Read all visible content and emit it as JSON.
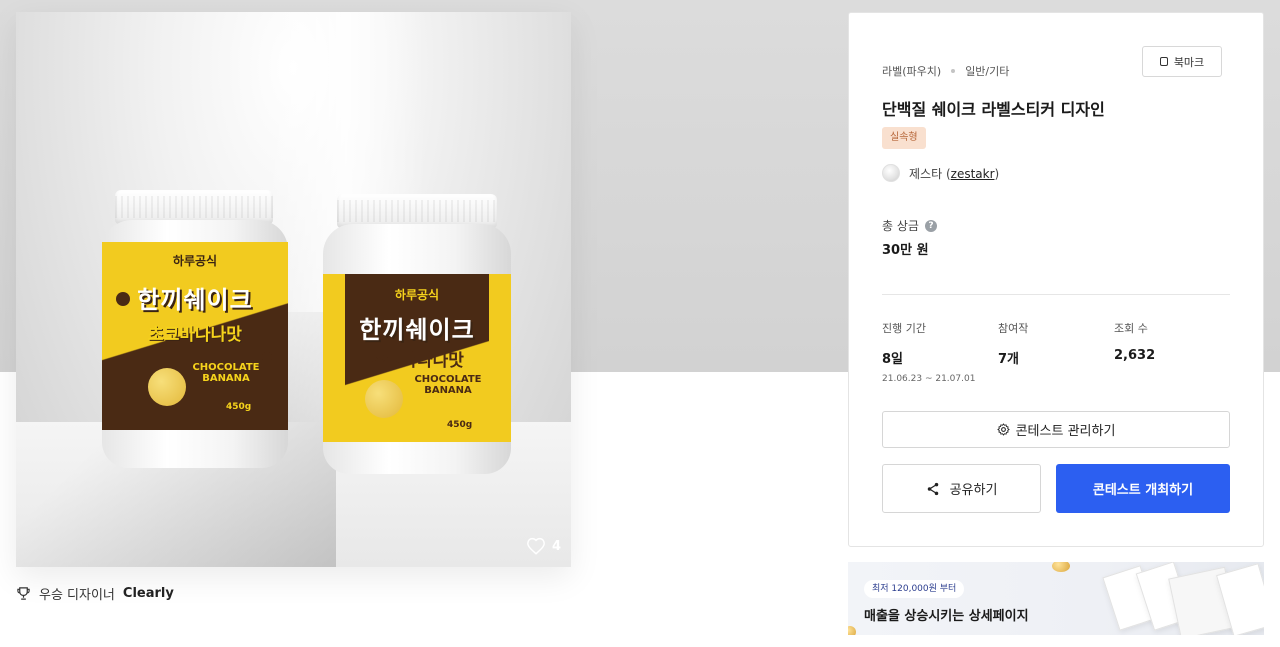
{
  "hero": {
    "like_count": "4",
    "jar_left": {
      "brand": "하루공식",
      "product": "한끼쉐이크",
      "flavor": "초코바나나맛",
      "english": "CHOCOLATE BANANA",
      "weight": "450g"
    },
    "jar_right": {
      "brand": "하루공식",
      "product": "한끼쉐이크",
      "flavor": "초코바나나맛",
      "english": "CHOCOLATE BANANA",
      "weight": "450g"
    }
  },
  "winner": {
    "label": "우승 디자이너",
    "name": "Clearly"
  },
  "card": {
    "breadcrumb": [
      "라벨(파우치)",
      "일반/기타"
    ],
    "bookmark_label": "북마크",
    "title": "단백질 쉐이크 라벨스티커 디자인",
    "tag": "실속형",
    "host_name": "제스타",
    "host_handle_open": "(",
    "host_handle": "zestakr",
    "host_handle_close": ")",
    "prize_label": "총 상금",
    "prize_value": "30만 원",
    "stats": {
      "period_label": "진행 기간",
      "period_value": "8일",
      "period_dates": "21.06.23 ~ 21.07.01",
      "entries_label": "참여작",
      "entries_value": "7개",
      "views_label": "조회 수",
      "views_value": "2,632"
    },
    "manage_label": "콘테스트 관리하기",
    "share_label": "공유하기",
    "host_button_label": "콘테스트 개최하기"
  },
  "ad": {
    "pill": "최저 120,000원 부터",
    "headline": "매출을 상승시키는 상세페이지"
  },
  "colors": {
    "primary": "#2c5ff1",
    "tag_bg": "#f9e0cf",
    "tag_text": "#b7673a",
    "label_yellow": "#f6d31c",
    "label_brown": "#4a2a14"
  },
  "icons": {
    "bookmark": "bookmark-icon",
    "help": "help-icon",
    "gear": "gear-icon",
    "share": "share-icon",
    "heart": "heart-icon",
    "trophy": "trophy-icon"
  }
}
